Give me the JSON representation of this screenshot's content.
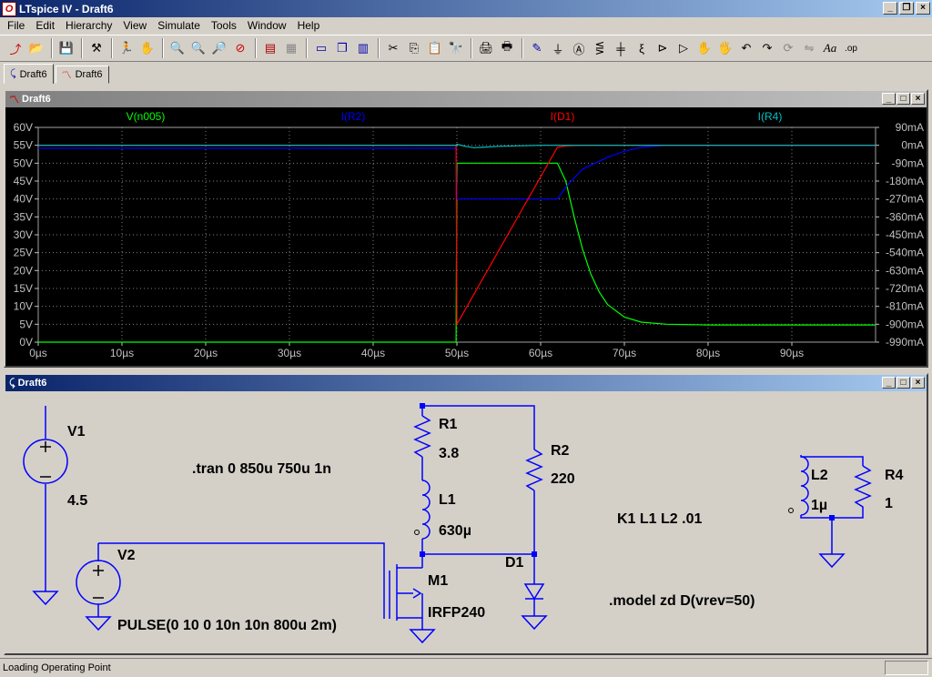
{
  "window": {
    "title": "LTspice IV - Draft6"
  },
  "menu": [
    "File",
    "Edit",
    "Hierarchy",
    "View",
    "Simulate",
    "Tools",
    "Window",
    "Help"
  ],
  "toolbar_icons": [
    "new-schematic-icon",
    "open-icon",
    "save-icon",
    "control-panel-icon",
    "run-icon",
    "halt-icon",
    "zoom-in-icon",
    "zoom-pan-icon",
    "zoom-out-icon",
    "zoom-cancel-icon",
    "autorange-icon",
    "grid-icon",
    "tile-horizontal-icon",
    "cascade-icon",
    "tile-vertical-icon",
    "cut-icon",
    "copy-icon",
    "paste-icon",
    "find-icon",
    "print-setup-icon",
    "print-icon",
    "wire-icon",
    "ground-icon",
    "label-icon",
    "resistor-icon",
    "capacitor-icon",
    "inductor-icon",
    "diode-icon",
    "component-icon",
    "move-icon",
    "drag-icon",
    "undo-icon",
    "redo-icon",
    "rotate-icon",
    "mirror-icon",
    "text-icon",
    "spice-directive-icon"
  ],
  "tabs": [
    {
      "label": "Draft6",
      "icon": "schematic-icon"
    },
    {
      "label": "Draft6",
      "icon": "waveform-icon"
    }
  ],
  "waveform_window": {
    "title": "Draft6"
  },
  "schematic_window": {
    "title": "Draft6"
  },
  "status": {
    "text": "Loading Operating Point"
  },
  "colors": {
    "vn005": "#00ff00",
    "ir2": "#0000ff",
    "id1": "#ff0000",
    "ir4": "#00c0c0",
    "plot_bg": "#000000",
    "schematic_bg": "#d4d0c8",
    "wire": "#0000ff"
  },
  "chart_data": {
    "type": "line",
    "xlabel": "",
    "x_ticks": [
      "0µs",
      "10µs",
      "20µs",
      "30µs",
      "40µs",
      "50µs",
      "60µs",
      "70µs",
      "80µs",
      "90µs"
    ],
    "xlim": [
      0,
      100
    ],
    "left_ticks": [
      "60V",
      "55V",
      "50V",
      "45V",
      "40V",
      "35V",
      "30V",
      "25V",
      "20V",
      "15V",
      "10V",
      "5V",
      "0V"
    ],
    "ylim_left": [
      0,
      60
    ],
    "right_ticks": [
      "90mA",
      "0mA",
      "-90mA",
      "-180mA",
      "-270mA",
      "-360mA",
      "-450mA",
      "-540mA",
      "-630mA",
      "-720mA",
      "-810mA",
      "-900mA",
      "-990mA"
    ],
    "ylim_right": [
      -990,
      90
    ],
    "series": [
      {
        "name": "V(n005)",
        "axis": "left",
        "color": "#00ff00",
        "x": [
          0,
          49.9,
          50,
          62,
          63,
          64,
          65,
          66,
          67,
          68,
          70,
          72,
          75,
          80,
          90,
          100
        ],
        "y": [
          0,
          0,
          50,
          50,
          45,
          35,
          26,
          19,
          14,
          10.5,
          7,
          5.6,
          5,
          4.8,
          4.8,
          4.8
        ]
      },
      {
        "name": "I(R2)",
        "axis": "right",
        "color": "#0000ff",
        "x": [
          0,
          49.9,
          50,
          62,
          63,
          65,
          68,
          70,
          72,
          75,
          100
        ],
        "y": [
          -15,
          -15,
          -270,
          -270,
          -210,
          -120,
          -60,
          -30,
          -10,
          0,
          0
        ]
      },
      {
        "name": "I(D1)",
        "axis": "right",
        "color": "#ff0000",
        "x": [
          0,
          49.9,
          50,
          62,
          63,
          65,
          70,
          100
        ],
        "y": [
          0,
          0,
          -900,
          -10,
          -3,
          0,
          0,
          0
        ]
      },
      {
        "name": "I(R4)",
        "axis": "right",
        "color": "#00c0c0",
        "x": [
          0,
          49.9,
          50,
          51,
          52,
          53,
          55,
          60,
          100
        ],
        "y": [
          0,
          0,
          5,
          -5,
          -12,
          -10,
          -5,
          0,
          0
        ]
      }
    ],
    "grid": "dotted"
  },
  "schematic": {
    "V1": {
      "name": "V1",
      "value": "4.5"
    },
    "V2": {
      "name": "V2",
      "value": "PULSE(0 10 0 10n 10n 800u 2m)"
    },
    "R1": {
      "name": "R1",
      "value": "3.8"
    },
    "R2": {
      "name": "R2",
      "value": "220"
    },
    "L1": {
      "name": "L1",
      "value": "630µ"
    },
    "M1": {
      "name": "M1",
      "value": "IRFP240"
    },
    "D1": {
      "name": "D1"
    },
    "L2": {
      "name": "L2",
      "value": "1µ"
    },
    "R4": {
      "name": "R4",
      "value": "1"
    },
    "tran": ".tran 0 850u 750u 1n",
    "coupling": "K1 L1 L2 .01",
    "model": ".model zd D(vrev=50)"
  }
}
